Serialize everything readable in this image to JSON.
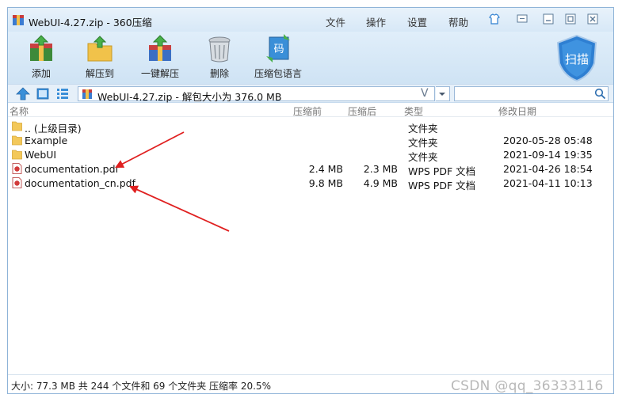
{
  "window": {
    "title": "WebUI-4.27.zip - 360压缩",
    "menu": [
      "文件",
      "操作",
      "设置",
      "帮助"
    ]
  },
  "toolbar": {
    "add_label": "添加",
    "extract_to_label": "解压到",
    "one_click_label": "一键解压",
    "delete_label": "删除",
    "comment_label": "压缩包语言",
    "scan_label": "扫描",
    "comment_icon_text": "码"
  },
  "address": {
    "path": "WebUI-4.27.zip - 解包大小为 376.0 MB",
    "v_glyph": "V",
    "search_placeholder": ""
  },
  "columns": {
    "name": "名称",
    "size": "压缩前",
    "packed": "压缩后",
    "type": "类型",
    "modified": "修改日期"
  },
  "files": [
    {
      "name": ".. (上级目录)",
      "size": "",
      "packed": "",
      "type": "文件夹",
      "modified": "",
      "icon": "folder-icon"
    },
    {
      "name": "Example",
      "size": "",
      "packed": "",
      "type": "文件夹",
      "modified": "2020-05-28 05:48",
      "icon": "folder-icon"
    },
    {
      "name": "WebUI",
      "size": "",
      "packed": "",
      "type": "文件夹",
      "modified": "2021-09-14 19:35",
      "icon": "folder-icon"
    },
    {
      "name": "documentation.pdf",
      "size": "2.4 MB",
      "packed": "2.3 MB",
      "type": "WPS PDF 文档",
      "modified": "2021-04-26 18:54",
      "icon": "pdf-icon"
    },
    {
      "name": "documentation_cn.pdf",
      "size": "9.8 MB",
      "packed": "4.9 MB",
      "type": "WPS PDF 文档",
      "modified": "2021-04-11 10:13",
      "icon": "pdf-icon"
    }
  ],
  "status": {
    "text": "大小: 77.3 MB 共 244 个文件和 69 个文件夹 压缩率 20.5%"
  },
  "watermark": "CSDN @qq_36333116",
  "colors": {
    "accent": "#2f7fd0",
    "folder": "#f3c85a",
    "pdf": "#d23b3b",
    "arrow": "#e02020"
  }
}
